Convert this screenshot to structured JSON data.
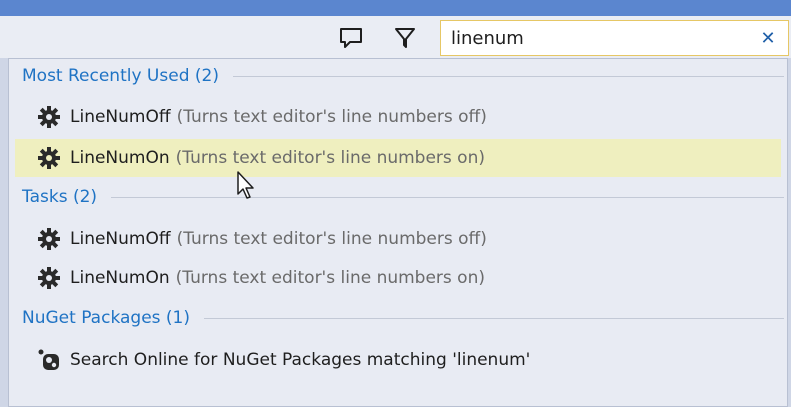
{
  "toolbar": {
    "feedback_icon": "speech-bubble-icon",
    "filter_icon": "filter-funnel-icon"
  },
  "search": {
    "value": "linenum",
    "clear_glyph": "✕"
  },
  "groups": [
    {
      "title": "Most Recently Used (2)",
      "items": [
        {
          "name": "LineNumOff",
          "desc": "(Turns text editor's line numbers off)",
          "icon": "gear-icon"
        },
        {
          "name": "LineNumOn",
          "desc": "(Turns text editor's line numbers on)",
          "icon": "gear-icon",
          "highlighted": true
        }
      ]
    },
    {
      "title": "Tasks (2)",
      "items": [
        {
          "name": "LineNumOff",
          "desc": "(Turns text editor's line numbers off)",
          "icon": "gear-icon"
        },
        {
          "name": "LineNumOn",
          "desc": "(Turns text editor's line numbers on)",
          "icon": "gear-icon"
        }
      ]
    },
    {
      "title": "NuGet Packages (1)",
      "items": [
        {
          "name": "Search Online for NuGet Packages matching 'linenum'",
          "desc": "",
          "icon": "nuget-icon"
        }
      ]
    }
  ],
  "colors": {
    "accent": "#1f73c4",
    "highlight": "#efefbf",
    "titlebar": "#5b86cf",
    "search_border": "#e6c765"
  }
}
